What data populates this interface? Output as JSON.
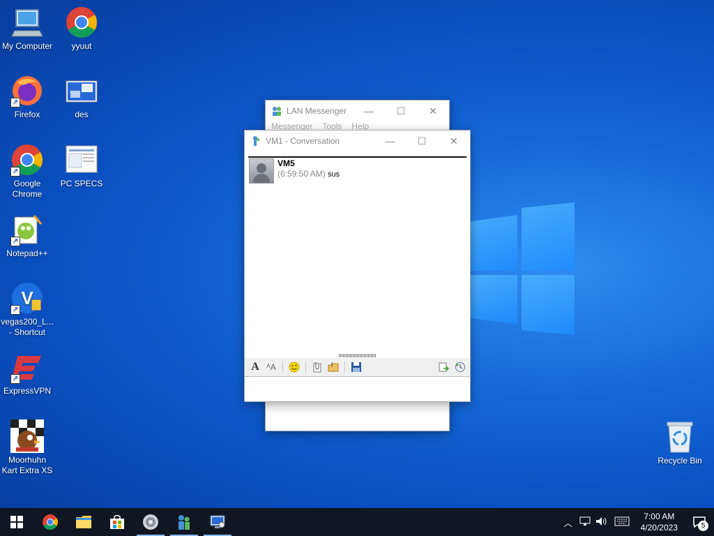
{
  "desktop": {
    "icons": [
      {
        "label": "My Computer"
      },
      {
        "label": "yyuut"
      },
      {
        "label": "Firefox"
      },
      {
        "label": "des"
      },
      {
        "label": "Google Chrome"
      },
      {
        "label": "PC SPECS"
      },
      {
        "label": "Notepad++"
      },
      {
        "label": "vegas200_L... - Shortcut"
      },
      {
        "label": "ExpressVPN"
      },
      {
        "label": "Moorhuhn Kart Extra XS"
      },
      {
        "label": "Recycle Bin"
      }
    ]
  },
  "lan_messenger": {
    "title": "LAN Messenger",
    "menu": [
      "Messenger",
      "Tools",
      "Help"
    ]
  },
  "conversation": {
    "title": "VM1 - Conversation",
    "message": {
      "sender": "VM5",
      "time": "(6:59:50 AM)",
      "text": "sus"
    }
  },
  "taskbar": {
    "time": "7:00 AM",
    "date": "4/20/2023",
    "notification_count": "5"
  }
}
